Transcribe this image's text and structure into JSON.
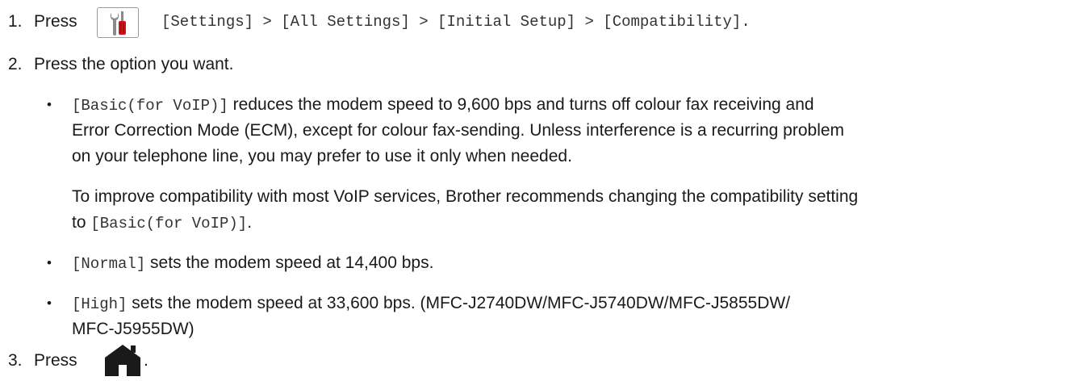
{
  "steps": [
    {
      "number": "1.",
      "press": "Press",
      "path": "[Settings] > [All Settings] > [Initial Setup] > [Compatibility].",
      "icon": "settings-tools-icon"
    },
    {
      "number": "2.",
      "text": "Press the option you want."
    },
    {
      "number": "3.",
      "press": "Press",
      "period": ".",
      "icon": "home-icon"
    }
  ],
  "options": [
    {
      "code": "[Basic(for VoIP)]",
      "lines": [
        " reduces the modem speed to 9,600 bps and turns off colour fax receiving and",
        "Error Correction Mode (ECM), except for colour fax-sending. Unless interference is a recurring problem",
        "on your telephone line, you may prefer to use it only when needed."
      ],
      "note_lines": [
        "To improve compatibility with most VoIP services, Brother recommends changing the compatibility setting",
        "to "
      ],
      "note_code": "[Basic(for VoIP)]",
      "note_end": "."
    },
    {
      "code": "[Normal]",
      "lines": [
        " sets the modem speed at 14,400 bps."
      ]
    },
    {
      "code": "[High]",
      "lines": [
        " sets the modem speed at 33,600 bps. (MFC-J2740DW/MFC-J5740DW/MFC-J5855DW/",
        "MFC-J5955DW)"
      ]
    }
  ],
  "bullet": "•",
  "colors": {
    "text": "#1a1a1a",
    "screwdriver_handle": "#d0141e",
    "tool_grey": "#8a8a8a",
    "home_icon": "#1a1a1a"
  }
}
